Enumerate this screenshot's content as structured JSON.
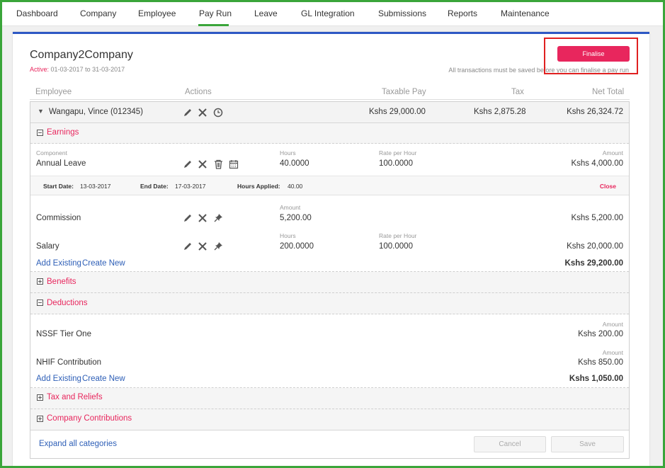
{
  "nav": {
    "items": [
      "Dashboard",
      "Company",
      "Employee",
      "Pay Run",
      "Leave",
      "GL Integration",
      "Submissions",
      "Reports",
      "Maintenance"
    ],
    "active_index": 3
  },
  "header": {
    "title": "Company2Company",
    "active_label": "Active:",
    "period": "01-03-2017 to 31-03-2017",
    "finalise_label": "Finalise",
    "finalise_note": "All transactions must be saved before you can finalise a pay run"
  },
  "columns": {
    "employee": "Employee",
    "actions": "Actions",
    "taxable_pay": "Taxable Pay",
    "tax": "Tax",
    "net_total": "Net Total"
  },
  "employee": {
    "name": "Wangapu, Vince (012345)",
    "taxable_pay": "Kshs 29,000.00",
    "tax": "Kshs 2,875.28",
    "net_total": "Kshs 26,324.72"
  },
  "earnings": {
    "title": "Earnings",
    "annual_leave": {
      "component_label": "Component",
      "name": "Annual Leave",
      "hours_label": "Hours",
      "hours": "40.0000",
      "rate_label": "Rate per Hour",
      "rate": "100.0000",
      "amount_label": "Amount",
      "amount": "Kshs 4,000.00"
    },
    "leave_detail": {
      "start_label": "Start Date:",
      "start": "13-03-2017",
      "end_label": "End Date:",
      "end": "17-03-2017",
      "hours_applied_label": "Hours Applied:",
      "hours_applied": "40.00",
      "close_label": "Close"
    },
    "commission": {
      "name": "Commission",
      "amount_label": "Amount",
      "amount_value": "5,200.00",
      "total": "Kshs 5,200.00"
    },
    "salary": {
      "name": "Salary",
      "hours_label": "Hours",
      "hours": "200.0000",
      "rate_label": "Rate per Hour",
      "rate": "100.0000",
      "total": "Kshs 20,000.00"
    },
    "add_existing": "Add Existing",
    "create_new": "Create New",
    "subtotal": "Kshs 29,200.00"
  },
  "benefits": {
    "title": "Benefits"
  },
  "deductions": {
    "title": "Deductions",
    "nssf": {
      "name": "NSSF Tier One",
      "amount_label": "Amount",
      "amount": "Kshs 200.00"
    },
    "nhif": {
      "name": "NHIF Contribution",
      "amount_label": "Amount",
      "amount": "Kshs 850.00"
    },
    "add_existing": "Add Existing",
    "create_new": "Create New",
    "subtotal": "Kshs 1,050.00"
  },
  "tax_reliefs": {
    "title": "Tax and Reliefs"
  },
  "company_contributions": {
    "title": "Company Contributions"
  },
  "footer": {
    "expand_all": "Expand all categories",
    "cancel_label": "Cancel",
    "save_label": "Save"
  },
  "colors": {
    "accent_pink": "#e8265d",
    "link_blue": "#2e5fb7",
    "nav_active_green": "#3aa53a",
    "card_top_blue": "#2d58c4"
  }
}
